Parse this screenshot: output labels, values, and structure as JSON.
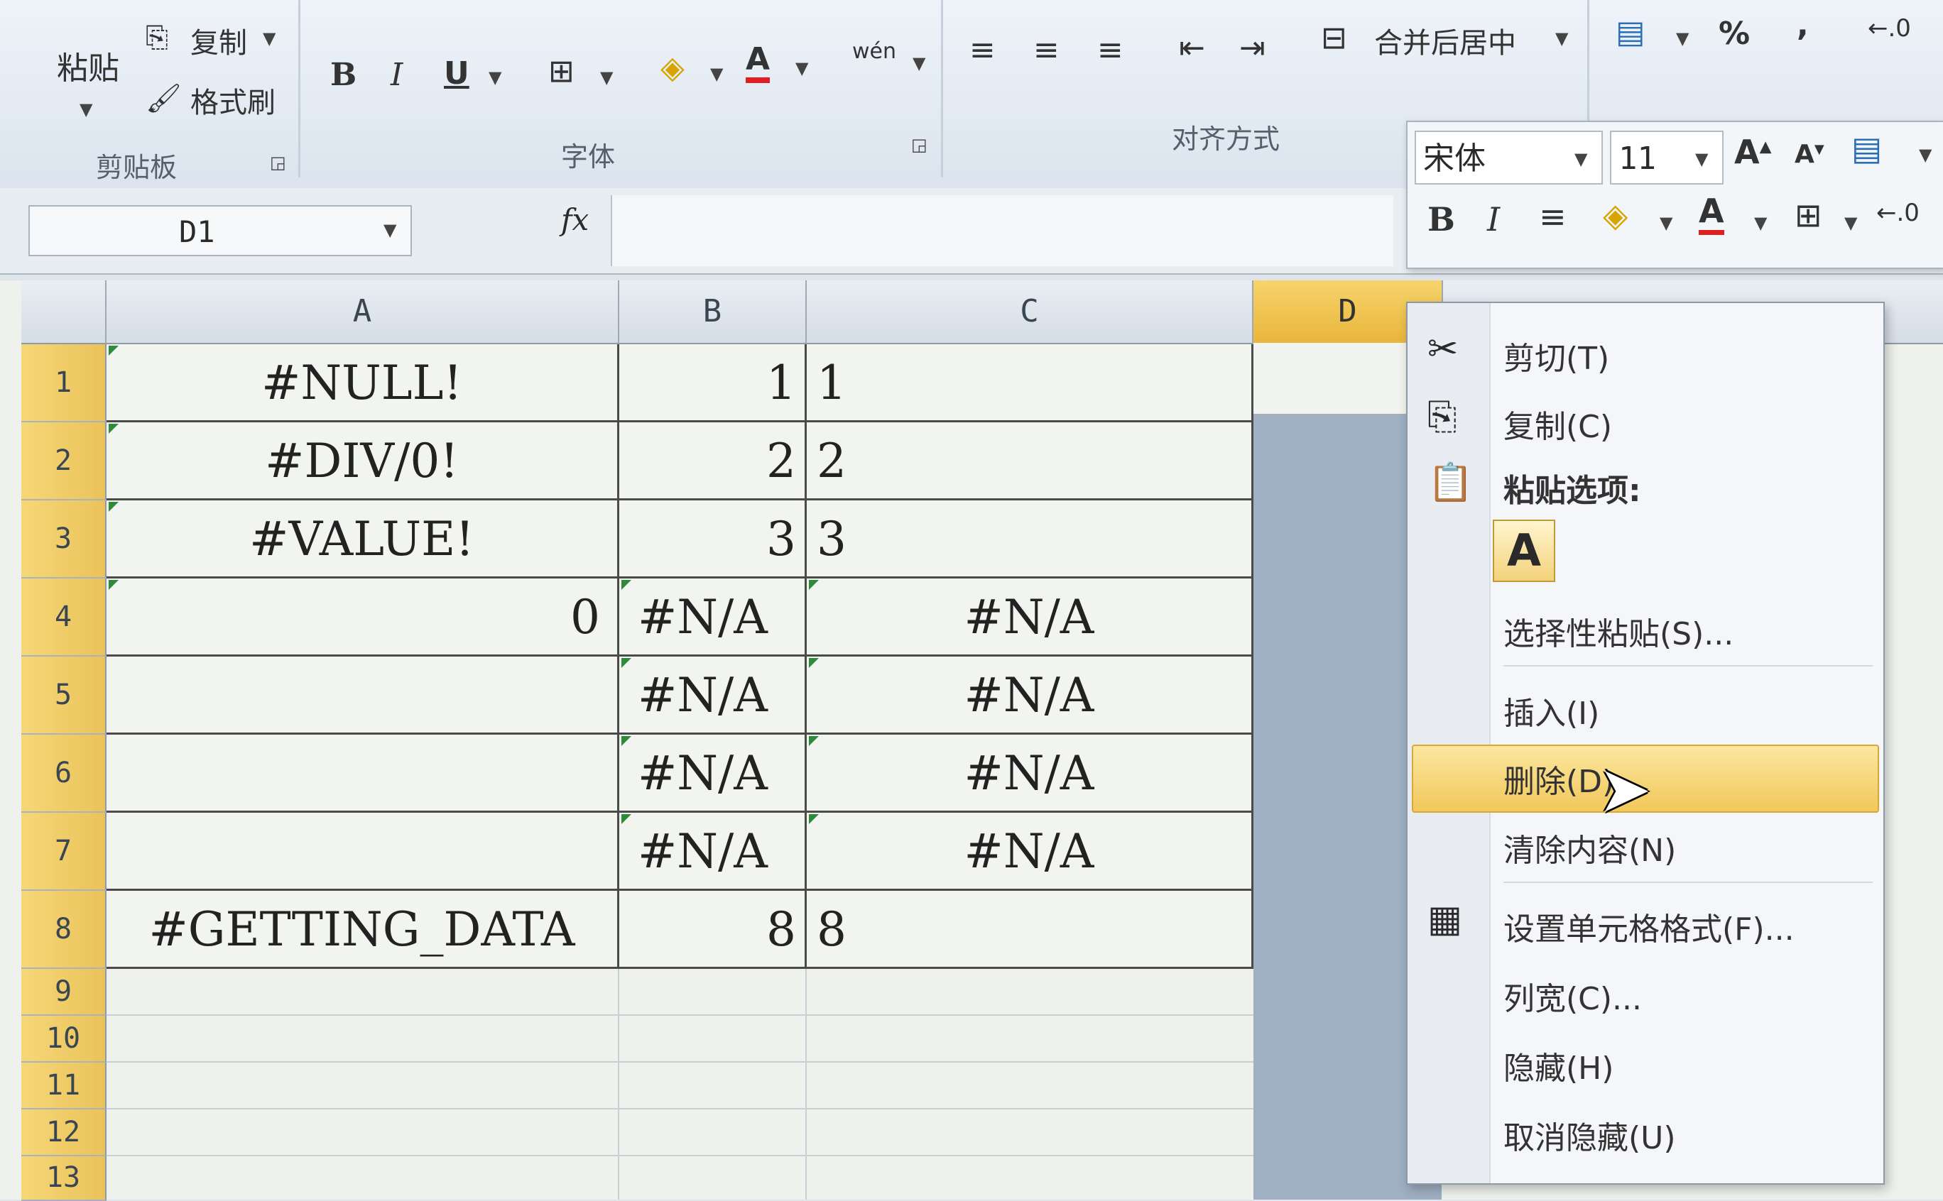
{
  "ribbon": {
    "clipboard": {
      "paste": "粘贴",
      "copy": "复制",
      "format_painter": "格式刷",
      "group_label": "剪贴板"
    },
    "font": {
      "bold": "B",
      "italic": "I",
      "underline": "U",
      "font_color": "A",
      "phonetic": "wén",
      "group_label": "字体"
    },
    "alignment": {
      "merge_center": "合并后居中",
      "group_label": "对齐方式"
    },
    "number": {
      "percent": "%",
      "comma": ","
    }
  },
  "mini_toolbar": {
    "font_name": "宋体",
    "font_size": "11",
    "bold": "B",
    "italic": "I",
    "font_color": "A"
  },
  "formula_bar": {
    "name_box": "D1",
    "fx": "fx"
  },
  "columns": [
    "A",
    "B",
    "C",
    "D"
  ],
  "rows": [
    "1",
    "2",
    "3",
    "4",
    "5",
    "6",
    "7",
    "8",
    "9",
    "10",
    "11",
    "12",
    "13"
  ],
  "cells": {
    "A1": "#NULL!",
    "A2": "#DIV/0!",
    "A3": "#VALUE!",
    "A4": "0",
    "A8": "#GETTING_DATA",
    "B1": "1",
    "B2": "2",
    "B3": "3",
    "B4": "#N/A",
    "B5": "#N/A",
    "B6": "#N/A",
    "B7": "#N/A",
    "B8": "8",
    "C1": "1",
    "C2": "2",
    "C3": "3",
    "C4": "#N/A",
    "C5": "#N/A",
    "C6": "#N/A",
    "C7": "#N/A",
    "C8": "8"
  },
  "context_menu": {
    "cut": "剪切(T)",
    "copy": "复制(C)",
    "paste_options": "粘贴选项:",
    "paste_a": "A",
    "paste_special": "选择性粘贴(S)...",
    "insert": "插入(I)",
    "delete": "删除(D)",
    "clear_contents": "清除内容(N)",
    "format_cells": "设置单元格格式(F)...",
    "column_width": "列宽(C)...",
    "hide": "隐藏(H)",
    "unhide": "取消隐藏(U)"
  },
  "colors": {
    "selection_gold": "#f1c85a",
    "selected_column": "#9fb0c3"
  }
}
